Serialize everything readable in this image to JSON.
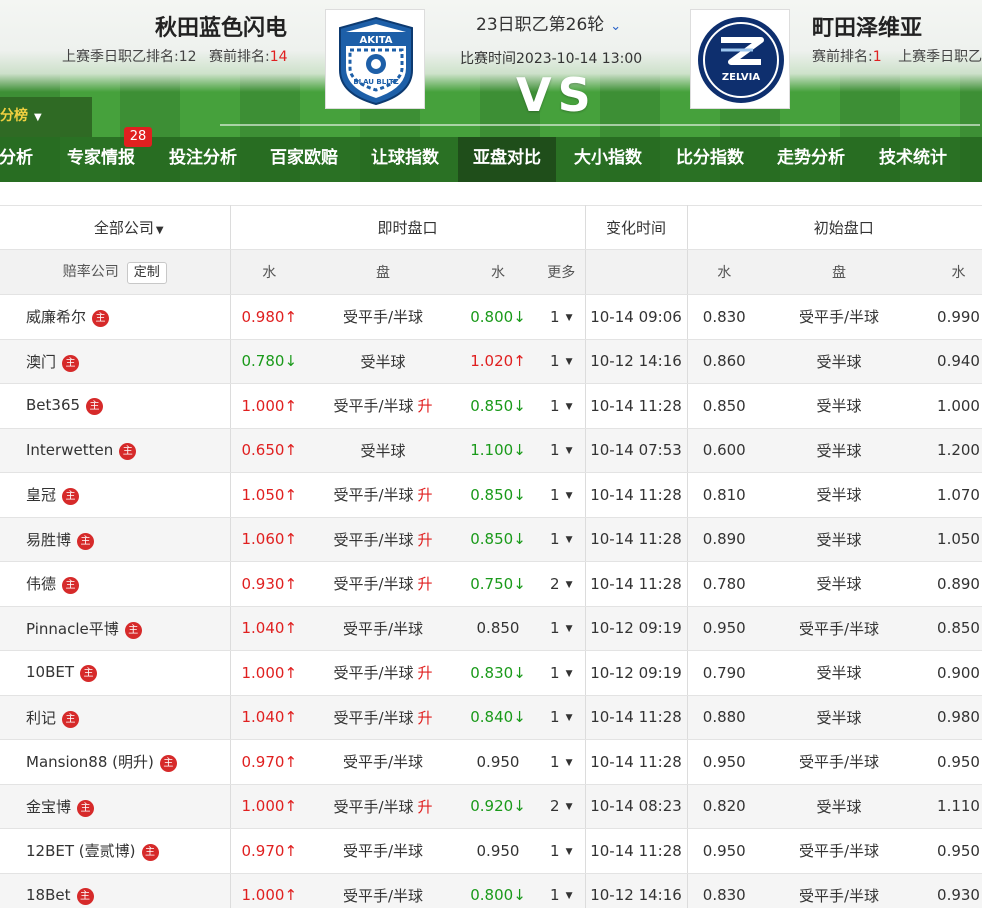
{
  "match": {
    "home_team": "秋田蓝色闪电",
    "home_last_rank_label": "上赛季日职乙排名:12",
    "home_pre_rank_label": "赛前排名:",
    "home_pre_rank_value": "14",
    "away_team": "町田泽维亚",
    "away_pre_rank_label": "赛前排名:",
    "away_pre_rank_value": "1",
    "away_last_rank_label": "上赛季日职乙",
    "round": "23日职乙第26轮",
    "match_time": "比赛时间2023-10-14 13:00",
    "vs": "VS",
    "home_logo_text_top": "AKITA",
    "home_logo_text_bottom": "BLAU BLITZ",
    "away_logo_text": "ZELVIA"
  },
  "standings_tab": {
    "label": "积分榜"
  },
  "nav": {
    "items": [
      {
        "label": "分析"
      },
      {
        "label": "专家情报"
      },
      {
        "label": "投注分析"
      },
      {
        "label": "百家欧赔"
      },
      {
        "label": "让球指数"
      },
      {
        "label": "亚盘对比"
      },
      {
        "label": "大小指数"
      },
      {
        "label": "比分指数"
      },
      {
        "label": "走势分析"
      },
      {
        "label": "技术统计"
      }
    ],
    "active_index": 5,
    "badge": "28"
  },
  "table": {
    "header1": {
      "all_companies": "全部公司",
      "live": "即时盘口",
      "change_time": "变化时间",
      "initial": "初始盘口"
    },
    "header2": {
      "company": "赔率公司",
      "customize": "定制",
      "water1": "水",
      "line": "盘",
      "water2": "水",
      "more": "更多",
      "init_water1": "水",
      "init_line": "盘",
      "init_water2": "水"
    },
    "main_badge": "主",
    "rise_label": "升",
    "rows": [
      {
        "company": "威廉希尔",
        "w1": "0.980",
        "w1_dir": "up",
        "line": "受平手/半球",
        "rise": false,
        "w2": "0.800",
        "w2_dir": "down",
        "more": "1",
        "time": "10-14 09:06",
        "iw1": "0.830",
        "iline": "受平手/半球",
        "iw2": "0.990"
      },
      {
        "company": "澳门",
        "w1": "0.780",
        "w1_dir": "down",
        "line": "受半球",
        "rise": false,
        "w2": "1.020",
        "w2_dir": "up",
        "more": "1",
        "time": "10-12 14:16",
        "iw1": "0.860",
        "iline": "受半球",
        "iw2": "0.940"
      },
      {
        "company": "Bet365",
        "w1": "1.000",
        "w1_dir": "up",
        "line": "受平手/半球",
        "rise": true,
        "w2": "0.850",
        "w2_dir": "down",
        "more": "1",
        "time": "10-14 11:28",
        "iw1": "0.850",
        "iline": "受半球",
        "iw2": "1.000"
      },
      {
        "company": "Interwetten",
        "w1": "0.650",
        "w1_dir": "up",
        "line": "受半球",
        "rise": false,
        "w2": "1.100",
        "w2_dir": "down",
        "more": "1",
        "time": "10-14 07:53",
        "iw1": "0.600",
        "iline": "受半球",
        "iw2": "1.200"
      },
      {
        "company": "皇冠",
        "w1": "1.050",
        "w1_dir": "up",
        "line": "受平手/半球",
        "rise": true,
        "w2": "0.850",
        "w2_dir": "down",
        "more": "1",
        "time": "10-14 11:28",
        "iw1": "0.810",
        "iline": "受半球",
        "iw2": "1.070"
      },
      {
        "company": "易胜博",
        "w1": "1.060",
        "w1_dir": "up",
        "line": "受平手/半球",
        "rise": true,
        "w2": "0.850",
        "w2_dir": "down",
        "more": "1",
        "time": "10-14 11:28",
        "iw1": "0.890",
        "iline": "受半球",
        "iw2": "1.050"
      },
      {
        "company": "伟德",
        "w1": "0.930",
        "w1_dir": "up",
        "line": "受平手/半球",
        "rise": true,
        "w2": "0.750",
        "w2_dir": "down",
        "more": "2",
        "time": "10-14 11:28",
        "iw1": "0.780",
        "iline": "受半球",
        "iw2": "0.890"
      },
      {
        "company": "Pinnacle平博",
        "w1": "1.040",
        "w1_dir": "up",
        "line": "受平手/半球",
        "rise": false,
        "w2": "0.850",
        "w2_dir": "none",
        "more": "1",
        "time": "10-12 09:19",
        "iw1": "0.950",
        "iline": "受平手/半球",
        "iw2": "0.850"
      },
      {
        "company": "10BET",
        "w1": "1.000",
        "w1_dir": "up",
        "line": "受平手/半球",
        "rise": true,
        "w2": "0.830",
        "w2_dir": "down",
        "more": "1",
        "time": "10-12 09:19",
        "iw1": "0.790",
        "iline": "受半球",
        "iw2": "0.900"
      },
      {
        "company": "利记",
        "w1": "1.040",
        "w1_dir": "up",
        "line": "受平手/半球",
        "rise": true,
        "w2": "0.840",
        "w2_dir": "down",
        "more": "1",
        "time": "10-14 11:28",
        "iw1": "0.880",
        "iline": "受半球",
        "iw2": "0.980"
      },
      {
        "company": "Mansion88 (明升)",
        "w1": "0.970",
        "w1_dir": "up",
        "line": "受平手/半球",
        "rise": false,
        "w2": "0.950",
        "w2_dir": "none",
        "more": "1",
        "time": "10-14 11:28",
        "iw1": "0.950",
        "iline": "受平手/半球",
        "iw2": "0.950"
      },
      {
        "company": "金宝博",
        "w1": "1.000",
        "w1_dir": "up",
        "line": "受平手/半球",
        "rise": true,
        "w2": "0.920",
        "w2_dir": "down",
        "more": "2",
        "time": "10-14 08:23",
        "iw1": "0.820",
        "iline": "受半球",
        "iw2": "1.110"
      },
      {
        "company": "12BET (壹贰博)",
        "w1": "0.970",
        "w1_dir": "up",
        "line": "受平手/半球",
        "rise": false,
        "w2": "0.950",
        "w2_dir": "none",
        "more": "1",
        "time": "10-14 11:28",
        "iw1": "0.950",
        "iline": "受平手/半球",
        "iw2": "0.950"
      },
      {
        "company": "18Bet",
        "w1": "1.000",
        "w1_dir": "up",
        "line": "受平手/半球",
        "rise": false,
        "w2": "0.800",
        "w2_dir": "down",
        "more": "1",
        "time": "10-12 14:16",
        "iw1": "0.830",
        "iline": "受平手/半球",
        "iw2": "0.930"
      }
    ]
  },
  "colors": {
    "up": "#e02020",
    "down": "#1a9a1a",
    "nav_bg": "#2f6a24",
    "badge": "#e02020"
  }
}
